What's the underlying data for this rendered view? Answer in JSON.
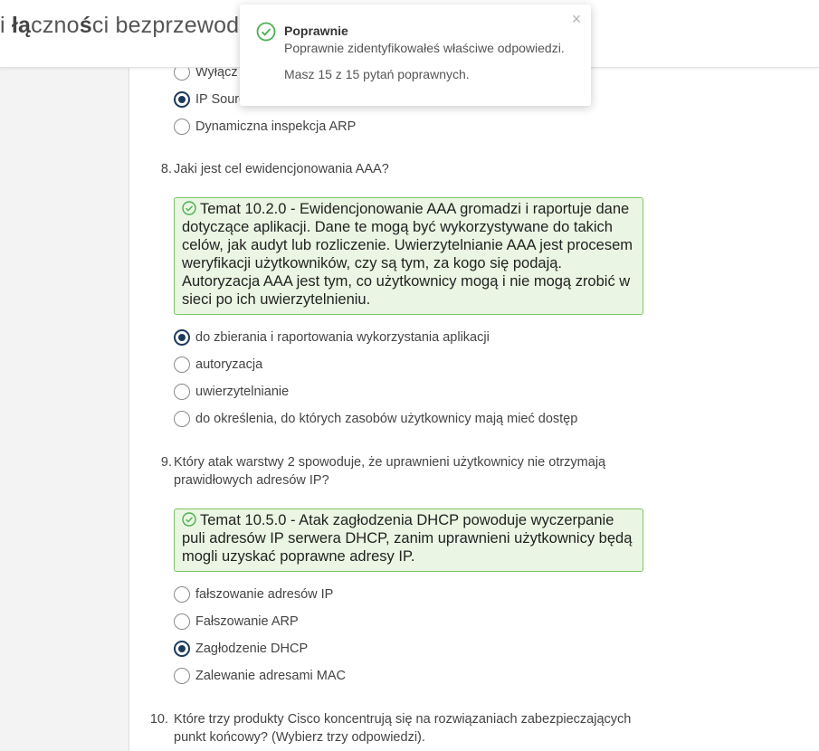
{
  "header": {
    "title_prefix": "i ",
    "title_bold1": "łą",
    "title_mid": "czno",
    "title_bold2": "ś",
    "title_rest": "ci bezprzewodo"
  },
  "toast": {
    "title": "Poprawnie",
    "message": "Poprawnie zidentyfikowałeś właściwe odpowiedzi.",
    "count": "Masz 15 z 15 pytań poprawnych.",
    "close_glyph": "×",
    "icon": "check-circle-icon",
    "accent": "#4caf50"
  },
  "q7": {
    "options": [
      {
        "label": "Wyłącz",
        "checked": false
      },
      {
        "label": "IP Source Guard",
        "checked": true
      },
      {
        "label": "Dynamiczna inspekcja ARP",
        "checked": false
      }
    ]
  },
  "q8": {
    "number": "8.",
    "text": "Jaki jest cel ewidencjonowania AAA?",
    "feedback": "Temat 10.2.0 - Ewidencjonowanie AAA gromadzi i raportuje dane dotyczące aplikacji. Dane te mogą być wykorzystywane do takich celów, jak audyt lub rozliczenie. Uwierzytelnianie AAA jest procesem weryfikacji użytkowników, czy są tym, za kogo się podają. Autoryzacja AAA jest tym, co użytkownicy mogą i nie mogą zrobić w sieci po ich uwierzytelnieniu.",
    "options": [
      {
        "label": "do zbierania i raportowania wykorzystania aplikacji",
        "checked": true
      },
      {
        "label": "autoryzacja",
        "checked": false
      },
      {
        "label": "uwierzytelnianie",
        "checked": false
      },
      {
        "label": "do określenia, do których zasobów użytkownicy mają mieć dostęp",
        "checked": false
      }
    ]
  },
  "q9": {
    "number": "9.",
    "text_line1": "Który atak warstwy 2 spowoduje, że uprawnieni użytkownicy nie otrzymają",
    "text_line2": "prawidłowych adresów IP?",
    "feedback": "Temat 10.5.0 - Atak zagłodzenia DHCP powoduje wyczerpanie puli adresów IP serwera DHCP, zanim uprawnieni użytkownicy będą mogli uzyskać poprawne adresy IP.",
    "options": [
      {
        "label": "fałszowanie adresów IP",
        "checked": false
      },
      {
        "label": "Fałszowanie ARP",
        "checked": false
      },
      {
        "label": "Zagłodzenie DHCP",
        "checked": true
      },
      {
        "label": "Zalewanie adresami MAC",
        "checked": false
      }
    ]
  },
  "q10": {
    "number": "10.",
    "text_line1": "Które trzy produkty Cisco koncentrują się na rozwiązaniach zabezpieczających",
    "text_line2": "punkt końcowy? (Wybierz trzy odpowiedzi)."
  },
  "colors": {
    "feedback_bg": "#eaf6e3",
    "feedback_border": "#7dc466",
    "radio_checked": "#1d3a5a"
  }
}
